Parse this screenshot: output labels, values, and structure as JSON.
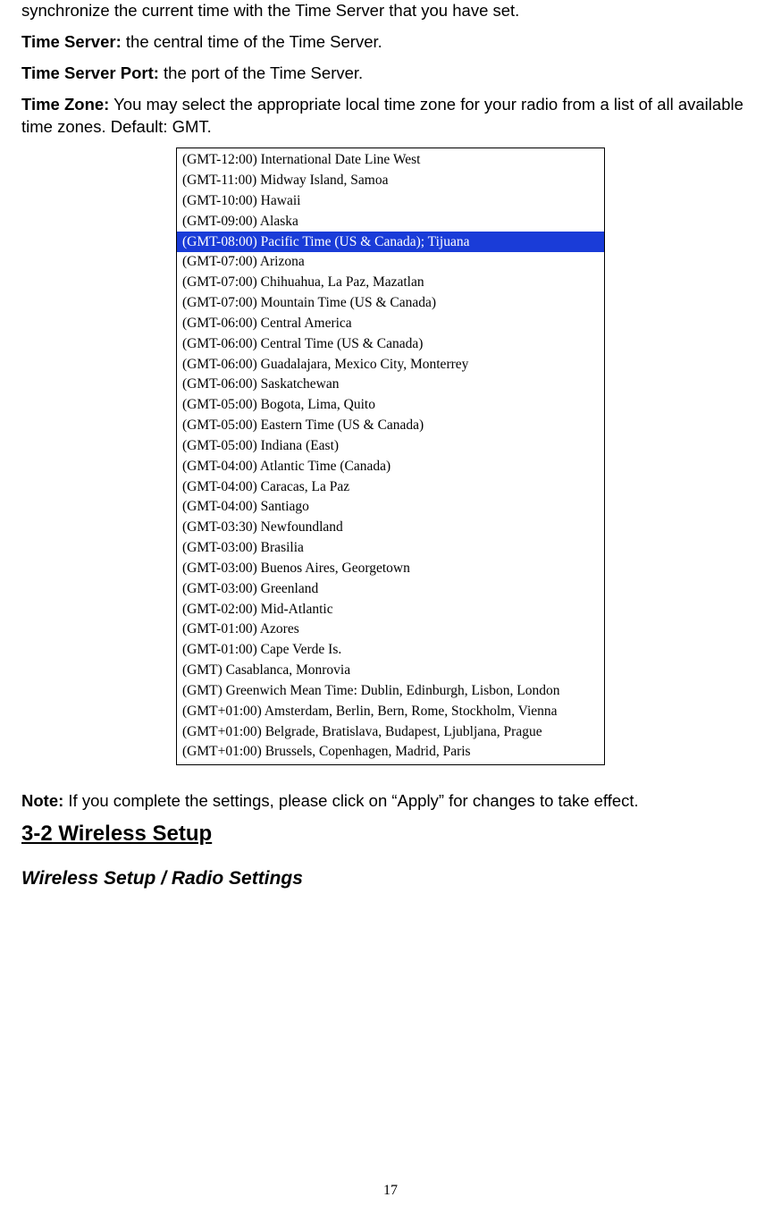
{
  "intro_line": "synchronize the current time with the Time Server that you have set.",
  "time_server": {
    "label": "Time Server:",
    "text": " the central time of the Time Server."
  },
  "time_server_port": {
    "label": "Time Server Port:",
    "text": " the port of the Time Server."
  },
  "time_zone": {
    "label": "Time Zone:",
    "text": " You may select the appropriate local time zone for your radio from a list of all available time zones. Default: GMT."
  },
  "timezones": {
    "selected_index": 4,
    "options": [
      "(GMT-12:00) International Date Line West",
      "(GMT-11:00) Midway Island, Samoa",
      "(GMT-10:00) Hawaii",
      "(GMT-09:00) Alaska",
      "(GMT-08:00) Pacific Time (US & Canada); Tijuana",
      "(GMT-07:00) Arizona",
      "(GMT-07:00) Chihuahua, La Paz, Mazatlan",
      "(GMT-07:00) Mountain Time (US & Canada)",
      "(GMT-06:00) Central America",
      "(GMT-06:00) Central Time (US & Canada)",
      "(GMT-06:00) Guadalajara, Mexico City, Monterrey",
      "(GMT-06:00) Saskatchewan",
      "(GMT-05:00) Bogota, Lima, Quito",
      "(GMT-05:00) Eastern Time (US & Canada)",
      "(GMT-05:00) Indiana (East)",
      "(GMT-04:00) Atlantic Time (Canada)",
      "(GMT-04:00) Caracas, La Paz",
      "(GMT-04:00) Santiago",
      "(GMT-03:30) Newfoundland",
      "(GMT-03:00) Brasilia",
      "(GMT-03:00) Buenos Aires, Georgetown",
      "(GMT-03:00) Greenland",
      "(GMT-02:00) Mid-Atlantic",
      "(GMT-01:00) Azores",
      "(GMT-01:00) Cape Verde Is.",
      "(GMT) Casablanca, Monrovia",
      "(GMT) Greenwich Mean Time: Dublin, Edinburgh, Lisbon, London",
      "(GMT+01:00) Amsterdam, Berlin, Bern, Rome, Stockholm, Vienna",
      "(GMT+01:00) Belgrade, Bratislava, Budapest, Ljubljana, Prague",
      "(GMT+01:00) Brussels, Copenhagen, Madrid, Paris"
    ]
  },
  "note": {
    "label": "Note:",
    "text": " If you complete the settings, please click on “Apply” for changes to take effect."
  },
  "section_heading": "3-2 Wireless Setup",
  "subsection_heading": "Wireless Setup / Radio Settings",
  "page_number": "17"
}
